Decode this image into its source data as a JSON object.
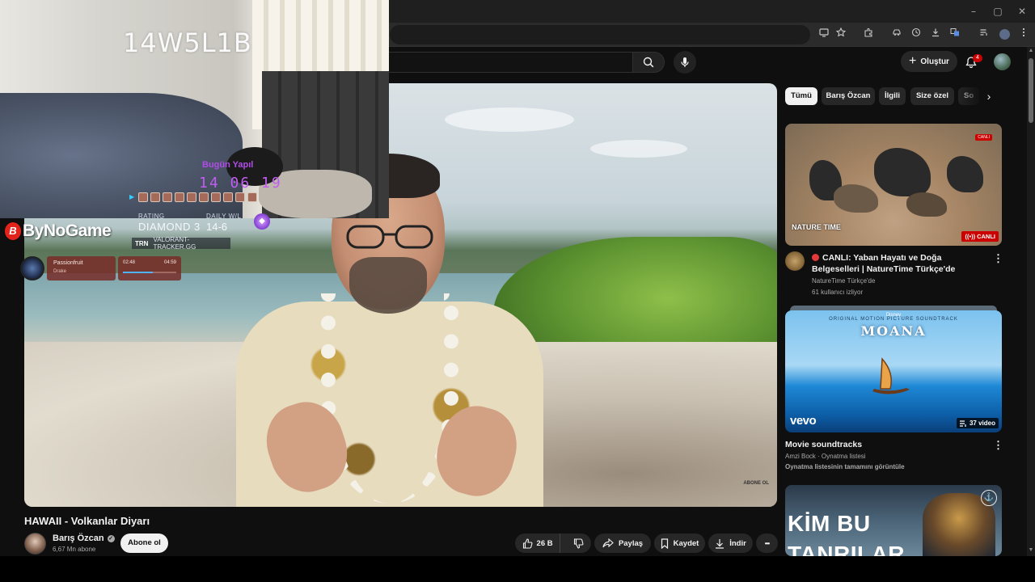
{
  "browser": {
    "window_controls": [
      "–",
      "▢",
      "✕"
    ],
    "toolbar_icons": [
      "cast-icon",
      "star-icon",
      "extension-icon",
      "extension-puzzle-icon",
      "history-icon",
      "download-icon",
      "translate-icon",
      "playlist-icon",
      "profile-icon",
      "more-icon"
    ]
  },
  "header": {
    "create_label": "Oluştur",
    "notification_count": "4"
  },
  "stream_overlay": {
    "webcam_code": "14W5L1B",
    "session_title": "Bugün Yapıl",
    "session_time": "14 06 19",
    "rating_label": "RATING",
    "rating_value": "DIAMOND 3",
    "daily_label": "DAILY W/L",
    "daily_value": "14-6",
    "tracker_brand": "TRN",
    "tracker_site": "VALORANT-TRACKER.GG",
    "sponsor_mark": "B",
    "sponsor_name": "ByNoGame",
    "music": {
      "track": "Passionfruit",
      "artist": "Drake",
      "elapsed": "02:48",
      "duration": "04:59",
      "progress": 0.56
    }
  },
  "video": {
    "title": "HAWAII - Volkanlar Diyarı",
    "channel": "Barış Özcan",
    "subscribers": "6,67 Mn abone",
    "subscribe_label": "Abone ol",
    "likes": "26 B",
    "share_label": "Paylaş",
    "save_label": "Kaydet",
    "download_label": "İndir",
    "more_label": "•••",
    "watermark": "ABONE OL"
  },
  "sidebar": {
    "chips": [
      "Tümü",
      "Barış Özcan",
      "İlgili",
      "Size özel",
      "So"
    ],
    "items": [
      {
        "title": "CANLI: Yaban Hayatı ve Doğa Belgeselleri | NatureTime Türkçe'de",
        "channel": "NatureTime Türkçe'de",
        "meta": "61 kullanıcı izliyor",
        "badge": "CANLI",
        "top_badge": "CANLI",
        "thumb_logo": "NATURE TIME"
      },
      {
        "title": "Movie soundtracks",
        "channel": "Amzi Bock · Oynatma listesi",
        "link": "Oynatma listesinin tamamını görüntüle",
        "badge": "37 video",
        "thumb_sub": "ORIGINAL MOTION PICTURE SOUNDTRACK",
        "thumb_disney": "Disney",
        "thumb_title": "MOANA",
        "thumb_brand": "vevo"
      },
      {
        "thumb_line1": "KİM BU",
        "thumb_line2": "TANRILAR",
        "thumb_mark": "⚓"
      }
    ]
  }
}
